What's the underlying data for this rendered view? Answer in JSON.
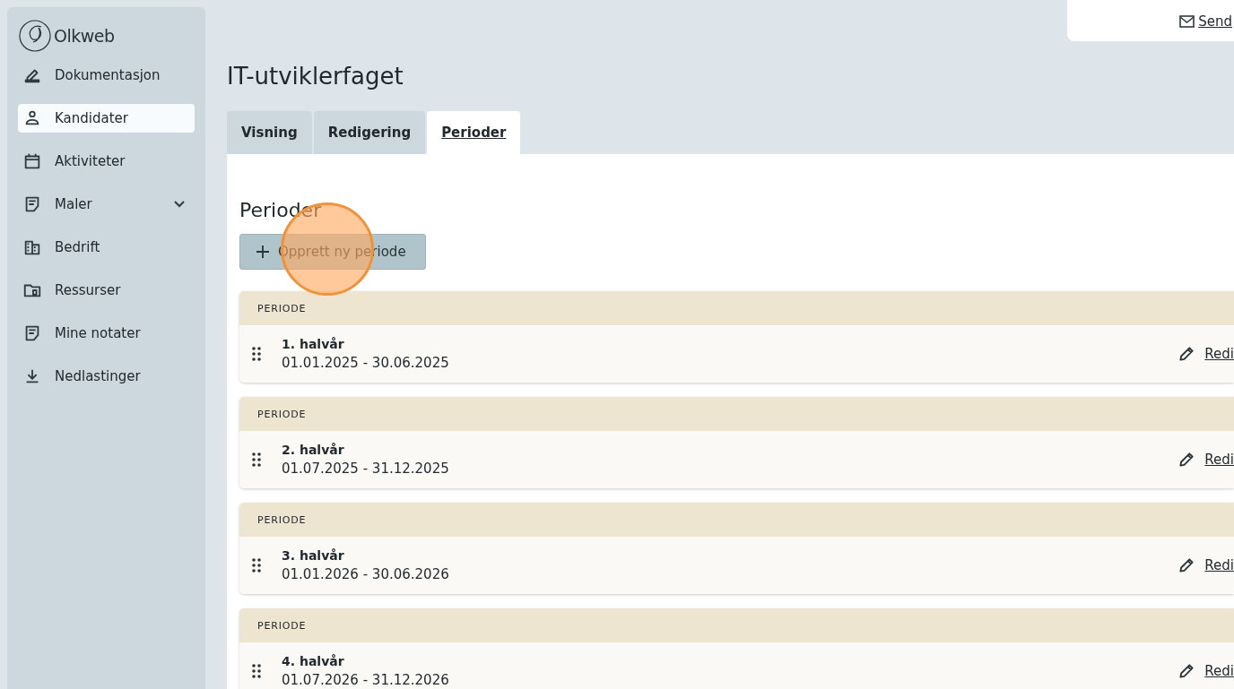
{
  "header": {
    "send_link": "Send"
  },
  "sidebar": {
    "logo": "Olkweb",
    "items": [
      {
        "label": "Dokumentasjon",
        "selected": false,
        "kind": "link"
      },
      {
        "label": "Kandidater",
        "selected": true,
        "kind": "link"
      },
      {
        "label": "Aktiviteter",
        "selected": false,
        "kind": "link"
      },
      {
        "label": "Maler",
        "selected": false,
        "kind": "group"
      },
      {
        "label": "Bedrift",
        "selected": false,
        "kind": "link"
      },
      {
        "label": "Ressurser",
        "selected": false,
        "kind": "link"
      },
      {
        "label": "Mine notater",
        "selected": false,
        "kind": "link"
      },
      {
        "label": "Nedlastinger",
        "selected": false,
        "kind": "link"
      }
    ]
  },
  "page_title": "IT-utviklerfaget",
  "tabs": [
    {
      "label": "Visning",
      "selected": false
    },
    {
      "label": "Redigering",
      "selected": false
    },
    {
      "label": "Perioder",
      "selected": true
    }
  ],
  "section_title": "Perioder",
  "create_button": "Opprett ny periode",
  "periods": [
    {
      "header": "PERIODE",
      "name": "1. halvår",
      "dates": "01.01.2025 - 30.06.2025",
      "edit": "Redi"
    },
    {
      "header": "PERIODE",
      "name": "2. halvår",
      "dates": "01.07.2025 - 31.12.2025",
      "edit": "Redi"
    },
    {
      "header": "PERIODE",
      "name": "3. halvår",
      "dates": "01.01.2026 - 30.06.2026",
      "edit": "Redi"
    },
    {
      "header": "PERIODE",
      "name": "4. halvår",
      "dates": "01.07.2026 - 31.12.2026",
      "edit": "Redi"
    }
  ]
}
